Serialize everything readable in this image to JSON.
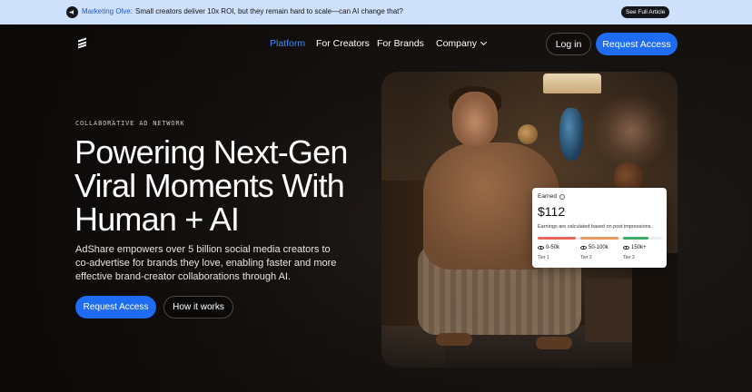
{
  "banner": {
    "tag": "Marketing Olve:",
    "message": "Small creators deliver 10x ROI, but they remain hard to scale—can AI change that?",
    "cta": "See Full Article"
  },
  "nav": {
    "items": [
      "Platform",
      "For Creators",
      "For Brands",
      "Company"
    ],
    "login": "Log in",
    "request_access": "Request Access"
  },
  "hero": {
    "eyebrow": "COLLABORATIVE AD NETWORK",
    "headline": "Powering Next-Gen Viral Moments With Human + AI",
    "lead": "AdShare empowers over 5 billion social media creators to co-advertise for brands they love, enabling faster and more effective brand-creator collaborations through AI.",
    "primary_cta": "Request Access",
    "secondary_cta": "How it works"
  },
  "earnings_card": {
    "label": "Earned",
    "amount": "$112",
    "note": "Earnings are calculated based on post impressions.",
    "tiers": [
      {
        "range": "0-50k",
        "name": "Tier 1",
        "color": "#e8675a"
      },
      {
        "range": "50-100k",
        "name": "Tier 2",
        "color": "#e89a5e"
      },
      {
        "range": "150k+",
        "name": "Tier 3",
        "color": "#3faa6b"
      }
    ]
  },
  "colors": {
    "accent": "#1f6bf2",
    "banner_bg": "#cfe0fb",
    "nav_active": "#3d8bff"
  }
}
